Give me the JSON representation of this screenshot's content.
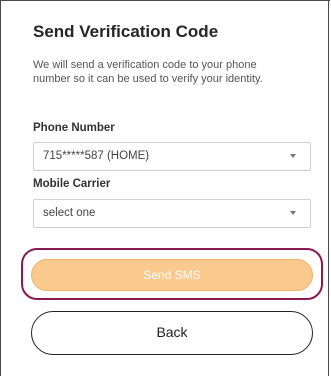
{
  "form": {
    "title": "Send Verification Code",
    "description": "We will send a verification code to your phone number so it can be used to verify your identity.",
    "phone_label": "Phone Number",
    "phone_value": "715*****587 (HOME)",
    "carrier_label": "Mobile Carrier",
    "carrier_value": "select one",
    "send_label": "Send SMS",
    "back_label": "Back"
  },
  "colors": {
    "send_button_bg": "#f9c98d",
    "highlight_ring": "#8a1a52",
    "back_border": "#222222"
  }
}
